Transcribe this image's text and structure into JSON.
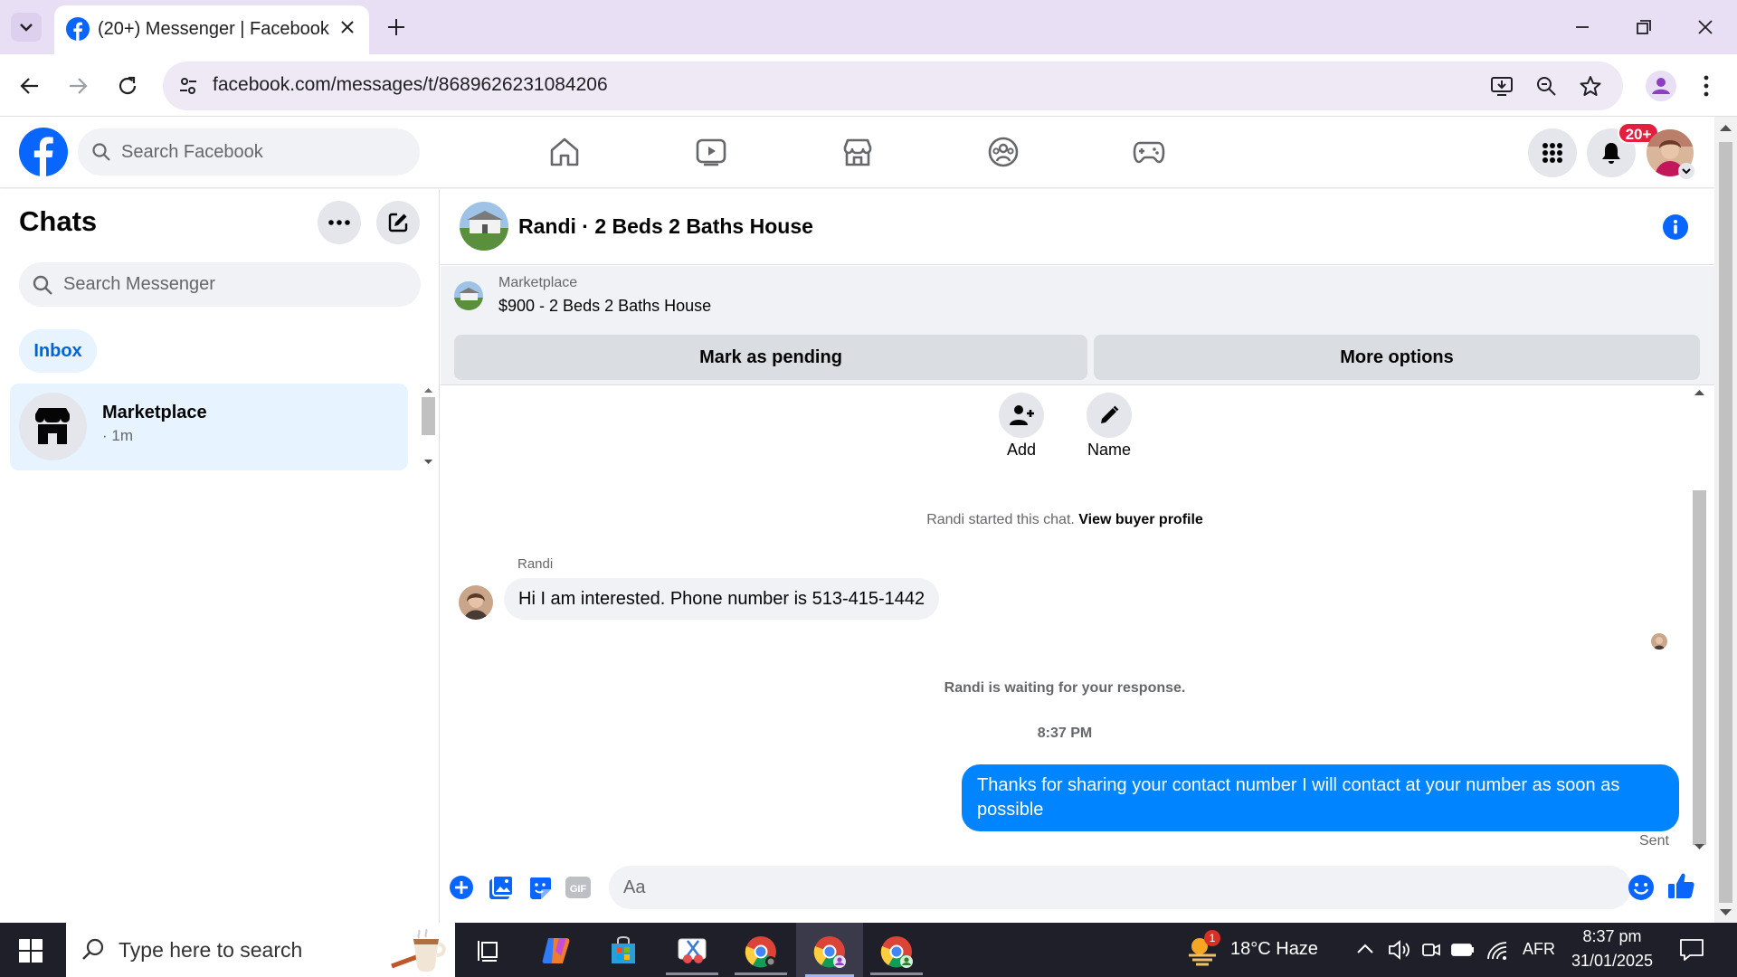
{
  "browser": {
    "tab_title": "(20+) Messenger | Facebook",
    "url": "facebook.com/messages/t/8689626231084206"
  },
  "facebook": {
    "search_placeholder": "Search Facebook",
    "notification_badge": "20+"
  },
  "chats_panel": {
    "title": "Chats",
    "search_placeholder": "Search Messenger",
    "filter_inbox": "Inbox",
    "items": [
      {
        "name": "Marketplace",
        "meta": "· 1m"
      }
    ]
  },
  "conversation": {
    "title": "Randi · 2 Beds 2 Baths House",
    "marketplace_label": "Marketplace",
    "listing": "$900 - 2 Beds 2 Baths House",
    "mark_pending": "Mark as pending",
    "more_options": "More options",
    "add_label": "Add",
    "name_label": "Name",
    "started_text": "Randi started this chat.",
    "view_profile": "View buyer profile",
    "sender_name": "Randi",
    "incoming_message": "Hi I am interested. Phone number is 513-415-1442",
    "waiting_text": "Randi is waiting for your response.",
    "timestamp": "8:37 PM",
    "outgoing_message": "Thanks for sharing your contact number I will contact at your number as soon as possible",
    "sent_status": "Sent",
    "composer_placeholder": "Aa"
  },
  "taskbar": {
    "search_placeholder": "Type here to search",
    "weather": "18°C  Haze",
    "weather_badge": "1",
    "language": "AFR",
    "time": "8:37 pm",
    "date": "31/01/2025"
  },
  "colors": {
    "facebook_blue": "#0866ff",
    "messenger_blue": "#0084ff",
    "notification_red": "#e41e3f"
  }
}
